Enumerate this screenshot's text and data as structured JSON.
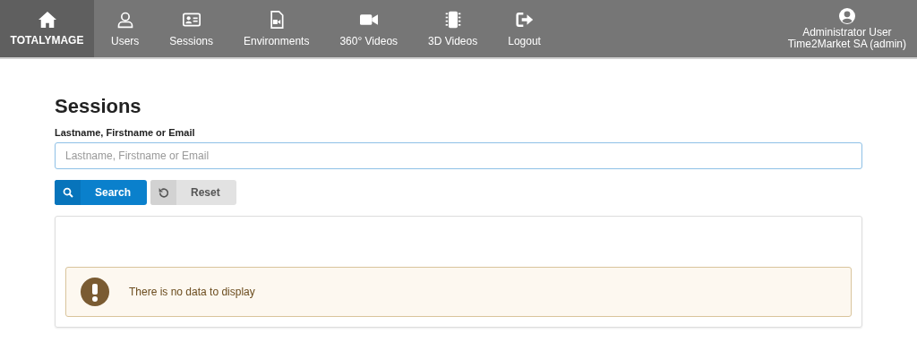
{
  "navbar": {
    "brand": "TOTALYMAGE",
    "items": [
      {
        "label": "Users"
      },
      {
        "label": "Sessions"
      },
      {
        "label": "Environments"
      },
      {
        "label": "360° Videos"
      },
      {
        "label": "3D Videos"
      },
      {
        "label": "Logout"
      }
    ],
    "user": {
      "name": "Administrator User",
      "organization": "Time2Market SA (admin)"
    }
  },
  "page": {
    "title": "Sessions",
    "search_label": "Lastname, Firstname or Email",
    "search_placeholder": "Lastname, Firstname or Email",
    "buttons": [
      {
        "label": "Search",
        "kind": "primary"
      },
      {
        "label": "Reset",
        "kind": "secondary"
      }
    ],
    "alert": "There is no data to display"
  }
}
